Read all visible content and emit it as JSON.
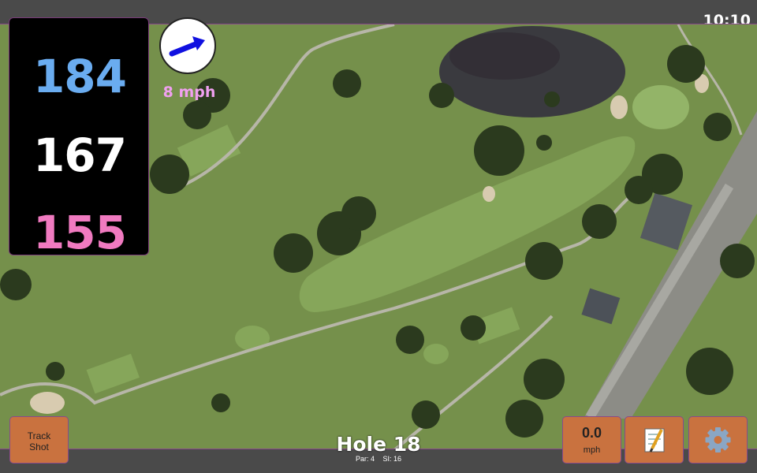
{
  "status": {
    "time": "10:10"
  },
  "distances": {
    "back": "184",
    "middle": "167",
    "front": "155"
  },
  "wind": {
    "speed": "8 mph",
    "direction_icon": "arrow-icon"
  },
  "hole": {
    "title": "Hole 18",
    "par": "Par: 4",
    "si": "SI: 16"
  },
  "buttons": {
    "track_shot_line1": "Track",
    "track_shot_line2": "Shot",
    "speed_value": "0.0",
    "speed_unit": "mph",
    "notes_icon": "notepad-icon",
    "settings_icon": "gear-icon"
  },
  "colors": {
    "back": "#6aacf0",
    "middle": "#ffffff",
    "front": "#f07ac0",
    "button": "#c9723f",
    "wind_text": "#f0a0f0"
  }
}
